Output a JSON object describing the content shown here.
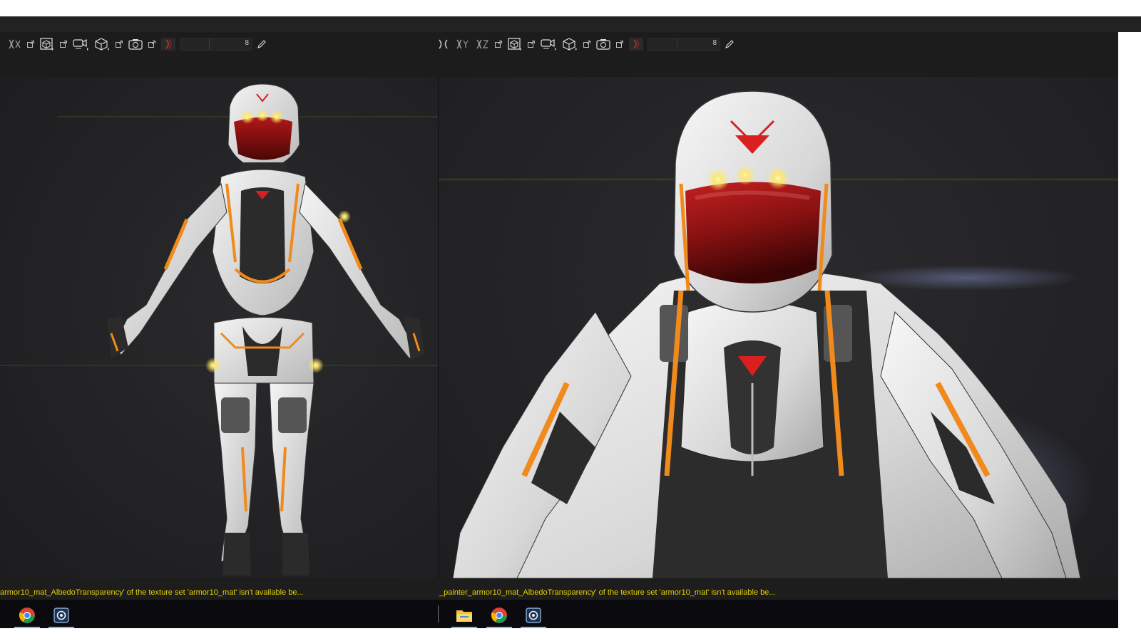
{
  "left_panel": {
    "toolbar": {
      "icons": [
        "sym-mirror-x-icon",
        "render-box-icon",
        "camera-icon",
        "orthographic-cube-icon",
        "screenshot-camera-icon",
        "sym-mirror-red-icon",
        "pencil-icon"
      ],
      "field_value": "8"
    },
    "status_message": "armor10_mat_AlbedoTransparency' of the texture set 'armor10_mat' isn't available be..."
  },
  "right_panel": {
    "toolbar": {
      "icons": [
        "sym-mirror-x-icon",
        "sym-mirror-y-icon",
        "sym-mirror-z-icon",
        "render-box-icon",
        "camera-icon",
        "orthographic-cube-icon",
        "screenshot-camera-icon",
        "sym-mirror-red-icon",
        "pencil-icon"
      ],
      "field_value": "8"
    },
    "status_message": "_painter_armor10_mat_AlbedoTransparency' of the texture set 'armor10_mat' isn't available be..."
  },
  "taskbar": {
    "left": [
      "chrome-icon",
      "substance-painter-icon"
    ],
    "right": [
      "file-explorer-icon",
      "chrome-icon",
      "substance-painter-icon"
    ]
  },
  "colors": {
    "status_text": "#e5d100",
    "accent_orange": "#f08a1c",
    "visor_red": "#8a1212",
    "glow_yellow": "#ffe86a",
    "taskbar_active": "#76b9ed"
  }
}
